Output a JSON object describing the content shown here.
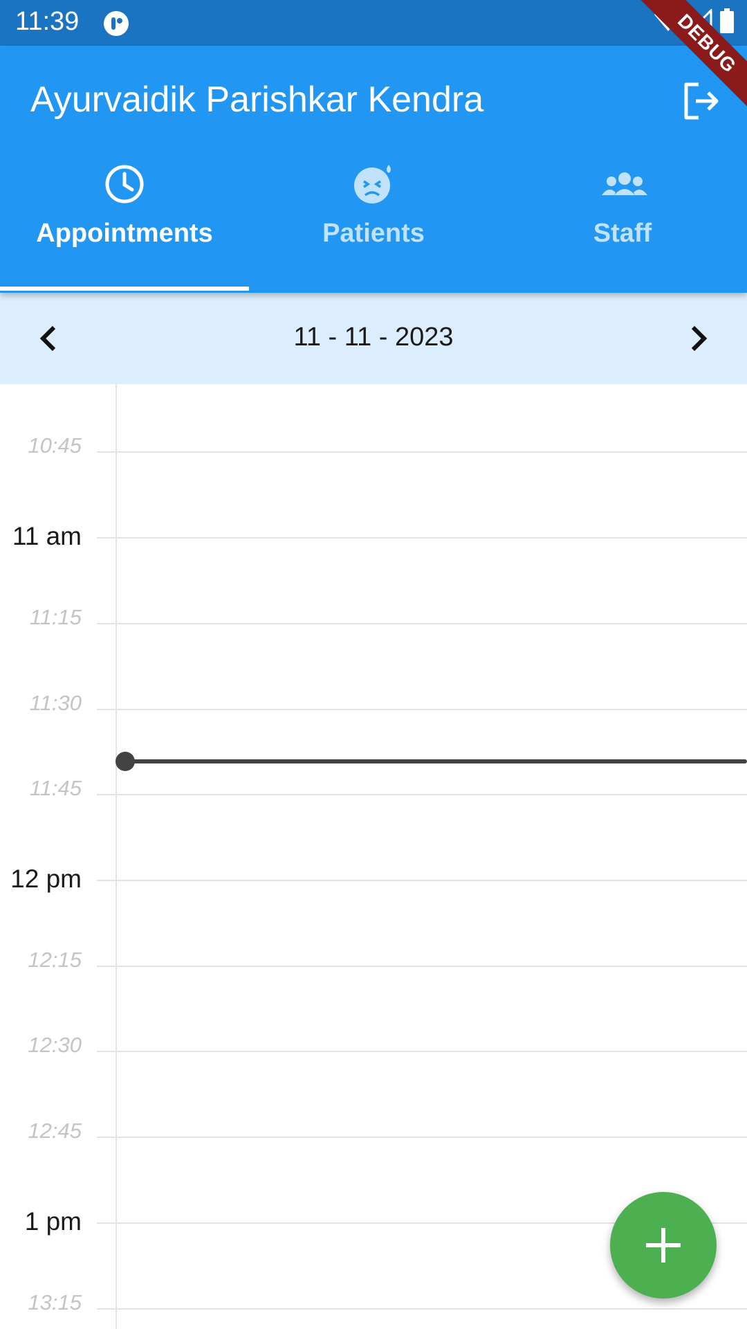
{
  "status_bar": {
    "time": "11:39",
    "icons": [
      "app-notification-icon",
      "wifi-icon",
      "signal-icon",
      "battery-icon"
    ]
  },
  "debug_banner": "DEBUG",
  "app_bar": {
    "title": "Ayurvaidik Parishkar Kendra",
    "logout_icon": "logout-icon",
    "background": "#2196f3"
  },
  "tabs": [
    {
      "label": "Appointments",
      "icon": "clock-icon",
      "active": true
    },
    {
      "label": "Patients",
      "icon": "sick-face-icon",
      "active": false
    },
    {
      "label": "Staff",
      "icon": "group-icon",
      "active": false
    }
  ],
  "date_nav": {
    "date": "11 - 11 - 2023",
    "prev_icon": "chevron-left-icon",
    "next_icon": "chevron-right-icon"
  },
  "timeline": {
    "slots": [
      {
        "label": "10:45",
        "kind": "minor"
      },
      {
        "label": "11 am",
        "kind": "major"
      },
      {
        "label": "11:15",
        "kind": "minor"
      },
      {
        "label": "11:30",
        "kind": "minor"
      },
      {
        "label": "11:45",
        "kind": "minor"
      },
      {
        "label": "12 pm",
        "kind": "major"
      },
      {
        "label": "12:15",
        "kind": "minor"
      },
      {
        "label": "12:30",
        "kind": "minor"
      },
      {
        "label": "12:45",
        "kind": "minor"
      },
      {
        "label": "1 pm",
        "kind": "major"
      },
      {
        "label": "13:15",
        "kind": "minor"
      }
    ],
    "current_time_indicator": "11:39"
  },
  "fab": {
    "icon": "plus-icon",
    "color": "#4caf50"
  }
}
